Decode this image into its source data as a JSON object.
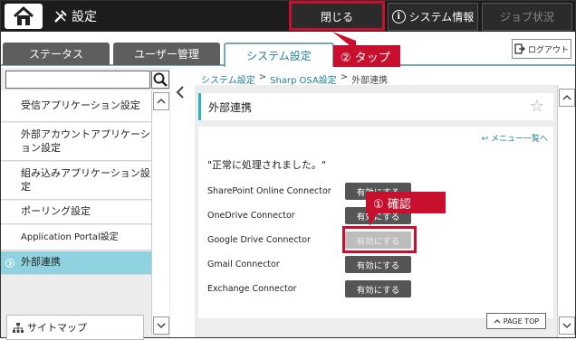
{
  "topbar": {
    "title": "設定",
    "close_label": "閉じる",
    "sysinfo_label": "システム情報",
    "jobstatus_label": "ジョブ状況"
  },
  "tabs": [
    {
      "label": "ステータス"
    },
    {
      "label": "ユーザー管理"
    },
    {
      "label": "システム設定"
    }
  ],
  "logout_label": "ログアウト",
  "annotations": {
    "tap": "② タップ",
    "confirm": "① 確認"
  },
  "sidebar": {
    "items": [
      {
        "label": "受信アプリケーション設定"
      },
      {
        "label": "外部アカウントアプリケーション設定"
      },
      {
        "label": "組み込みアプリケーション設定"
      },
      {
        "label": "ポーリング設定"
      },
      {
        "label": "Application Portal設定"
      },
      {
        "label": "外部連携"
      }
    ],
    "sitemap_label": "サイトマップ"
  },
  "breadcrumb": {
    "items": [
      "システム設定",
      "Sharp OSA設定",
      "外部連携"
    ],
    "sep": ">"
  },
  "main": {
    "heading": "外部連携",
    "menu_link": "メニュー一覧へ",
    "status_message": "\"正常に処理されました。\"",
    "connectors": [
      {
        "name": "SharePoint Online Connector",
        "button": "有効にする"
      },
      {
        "name": "OneDrive Connector",
        "button": "有効にする"
      },
      {
        "name": "Google Drive Connector",
        "button": "有効にする"
      },
      {
        "name": "Gmail Connector",
        "button": "有効にする"
      },
      {
        "name": "Exchange Connector",
        "button": "有効にする"
      }
    ],
    "pagetop_label": "PAGE TOP"
  },
  "colors": {
    "accent": "#1d7e95",
    "highlight_red": "#c8102e",
    "active_side": "#8fd3e0"
  }
}
